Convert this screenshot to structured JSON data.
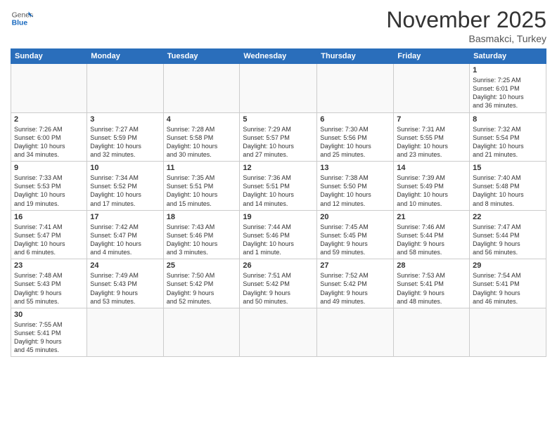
{
  "header": {
    "logo_general": "General",
    "logo_blue": "Blue",
    "month_title": "November 2025",
    "location": "Basmakci, Turkey"
  },
  "weekdays": [
    "Sunday",
    "Monday",
    "Tuesday",
    "Wednesday",
    "Thursday",
    "Friday",
    "Saturday"
  ],
  "weeks": [
    [
      {
        "day": "",
        "info": ""
      },
      {
        "day": "",
        "info": ""
      },
      {
        "day": "",
        "info": ""
      },
      {
        "day": "",
        "info": ""
      },
      {
        "day": "",
        "info": ""
      },
      {
        "day": "",
        "info": ""
      },
      {
        "day": "1",
        "info": "Sunrise: 7:25 AM\nSunset: 6:01 PM\nDaylight: 10 hours\nand 36 minutes."
      }
    ],
    [
      {
        "day": "2",
        "info": "Sunrise: 7:26 AM\nSunset: 6:00 PM\nDaylight: 10 hours\nand 34 minutes."
      },
      {
        "day": "3",
        "info": "Sunrise: 7:27 AM\nSunset: 5:59 PM\nDaylight: 10 hours\nand 32 minutes."
      },
      {
        "day": "4",
        "info": "Sunrise: 7:28 AM\nSunset: 5:58 PM\nDaylight: 10 hours\nand 30 minutes."
      },
      {
        "day": "5",
        "info": "Sunrise: 7:29 AM\nSunset: 5:57 PM\nDaylight: 10 hours\nand 27 minutes."
      },
      {
        "day": "6",
        "info": "Sunrise: 7:30 AM\nSunset: 5:56 PM\nDaylight: 10 hours\nand 25 minutes."
      },
      {
        "day": "7",
        "info": "Sunrise: 7:31 AM\nSunset: 5:55 PM\nDaylight: 10 hours\nand 23 minutes."
      },
      {
        "day": "8",
        "info": "Sunrise: 7:32 AM\nSunset: 5:54 PM\nDaylight: 10 hours\nand 21 minutes."
      }
    ],
    [
      {
        "day": "9",
        "info": "Sunrise: 7:33 AM\nSunset: 5:53 PM\nDaylight: 10 hours\nand 19 minutes."
      },
      {
        "day": "10",
        "info": "Sunrise: 7:34 AM\nSunset: 5:52 PM\nDaylight: 10 hours\nand 17 minutes."
      },
      {
        "day": "11",
        "info": "Sunrise: 7:35 AM\nSunset: 5:51 PM\nDaylight: 10 hours\nand 15 minutes."
      },
      {
        "day": "12",
        "info": "Sunrise: 7:36 AM\nSunset: 5:51 PM\nDaylight: 10 hours\nand 14 minutes."
      },
      {
        "day": "13",
        "info": "Sunrise: 7:38 AM\nSunset: 5:50 PM\nDaylight: 10 hours\nand 12 minutes."
      },
      {
        "day": "14",
        "info": "Sunrise: 7:39 AM\nSunset: 5:49 PM\nDaylight: 10 hours\nand 10 minutes."
      },
      {
        "day": "15",
        "info": "Sunrise: 7:40 AM\nSunset: 5:48 PM\nDaylight: 10 hours\nand 8 minutes."
      }
    ],
    [
      {
        "day": "16",
        "info": "Sunrise: 7:41 AM\nSunset: 5:47 PM\nDaylight: 10 hours\nand 6 minutes."
      },
      {
        "day": "17",
        "info": "Sunrise: 7:42 AM\nSunset: 5:47 PM\nDaylight: 10 hours\nand 4 minutes."
      },
      {
        "day": "18",
        "info": "Sunrise: 7:43 AM\nSunset: 5:46 PM\nDaylight: 10 hours\nand 3 minutes."
      },
      {
        "day": "19",
        "info": "Sunrise: 7:44 AM\nSunset: 5:46 PM\nDaylight: 10 hours\nand 1 minute."
      },
      {
        "day": "20",
        "info": "Sunrise: 7:45 AM\nSunset: 5:45 PM\nDaylight: 9 hours\nand 59 minutes."
      },
      {
        "day": "21",
        "info": "Sunrise: 7:46 AM\nSunset: 5:44 PM\nDaylight: 9 hours\nand 58 minutes."
      },
      {
        "day": "22",
        "info": "Sunrise: 7:47 AM\nSunset: 5:44 PM\nDaylight: 9 hours\nand 56 minutes."
      }
    ],
    [
      {
        "day": "23",
        "info": "Sunrise: 7:48 AM\nSunset: 5:43 PM\nDaylight: 9 hours\nand 55 minutes."
      },
      {
        "day": "24",
        "info": "Sunrise: 7:49 AM\nSunset: 5:43 PM\nDaylight: 9 hours\nand 53 minutes."
      },
      {
        "day": "25",
        "info": "Sunrise: 7:50 AM\nSunset: 5:42 PM\nDaylight: 9 hours\nand 52 minutes."
      },
      {
        "day": "26",
        "info": "Sunrise: 7:51 AM\nSunset: 5:42 PM\nDaylight: 9 hours\nand 50 minutes."
      },
      {
        "day": "27",
        "info": "Sunrise: 7:52 AM\nSunset: 5:42 PM\nDaylight: 9 hours\nand 49 minutes."
      },
      {
        "day": "28",
        "info": "Sunrise: 7:53 AM\nSunset: 5:41 PM\nDaylight: 9 hours\nand 48 minutes."
      },
      {
        "day": "29",
        "info": "Sunrise: 7:54 AM\nSunset: 5:41 PM\nDaylight: 9 hours\nand 46 minutes."
      }
    ],
    [
      {
        "day": "30",
        "info": "Sunrise: 7:55 AM\nSunset: 5:41 PM\nDaylight: 9 hours\nand 45 minutes."
      },
      {
        "day": "",
        "info": ""
      },
      {
        "day": "",
        "info": ""
      },
      {
        "day": "",
        "info": ""
      },
      {
        "day": "",
        "info": ""
      },
      {
        "day": "",
        "info": ""
      },
      {
        "day": "",
        "info": ""
      }
    ]
  ]
}
